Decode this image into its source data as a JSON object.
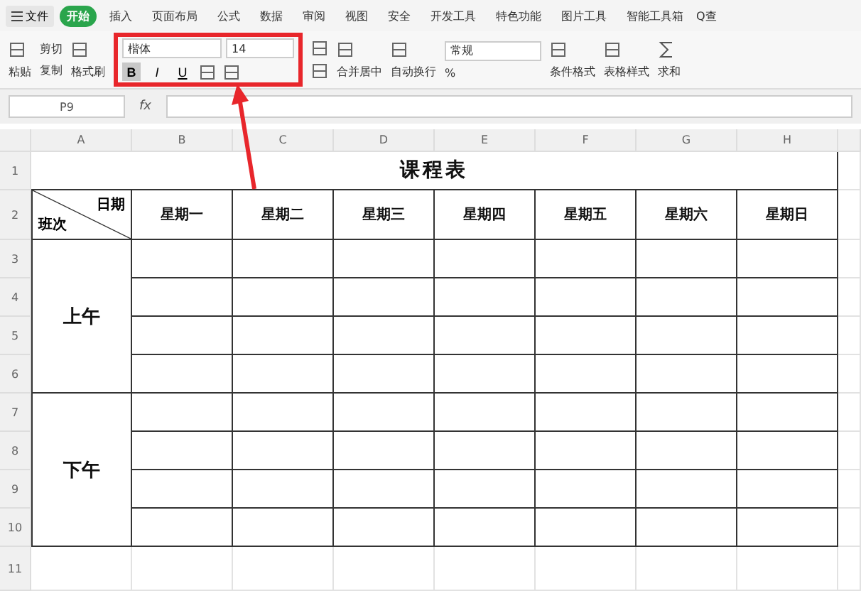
{
  "menu": {
    "file": "文件",
    "tabs": [
      {
        "label": "开始",
        "selected": true
      },
      {
        "label": "插入",
        "selected": false
      },
      {
        "label": "页面布局",
        "selected": false
      },
      {
        "label": "公式",
        "selected": false
      },
      {
        "label": "数据",
        "selected": false
      },
      {
        "label": "审阅",
        "selected": false
      },
      {
        "label": "视图",
        "selected": false
      },
      {
        "label": "安全",
        "selected": false
      },
      {
        "label": "开发工具",
        "selected": false
      },
      {
        "label": "特色功能",
        "selected": false
      },
      {
        "label": "图片工具",
        "selected": false
      },
      {
        "label": "智能工具箱",
        "selected": false
      }
    ],
    "search": "Q查"
  },
  "ribbon": {
    "paste": "粘贴",
    "cut": "剪切",
    "copy": "复制",
    "format_painter": "格式刷",
    "font_name": "楷体",
    "font_size": "14",
    "styles": [
      {
        "label": "B",
        "kind": "bold",
        "on": true
      },
      {
        "label": "I",
        "kind": "italic",
        "on": false
      },
      {
        "label": "U",
        "kind": "underline",
        "on": false
      }
    ],
    "merge": "合并居中",
    "wrap": "自动换行",
    "number_format": "常规",
    "percent": "%",
    "conditional": "条件格式",
    "table_style": "表格样式",
    "sum": "求和"
  },
  "formula_bar": {
    "cell": "P9",
    "fx": "fx"
  },
  "sheet": {
    "columns": [
      "A",
      "B",
      "C",
      "D",
      "E",
      "F",
      "G",
      "H"
    ],
    "rows": [
      "1",
      "2",
      "3",
      "4",
      "5",
      "6",
      "7",
      "8",
      "9",
      "10",
      "11"
    ],
    "title": "课程表",
    "corner_top": "日期",
    "corner_bottom": "班次",
    "days": [
      "星期一",
      "星期二",
      "星期三",
      "星期四",
      "星期五",
      "星期六",
      "星期日"
    ],
    "periods": [
      "上午",
      "下午"
    ]
  }
}
